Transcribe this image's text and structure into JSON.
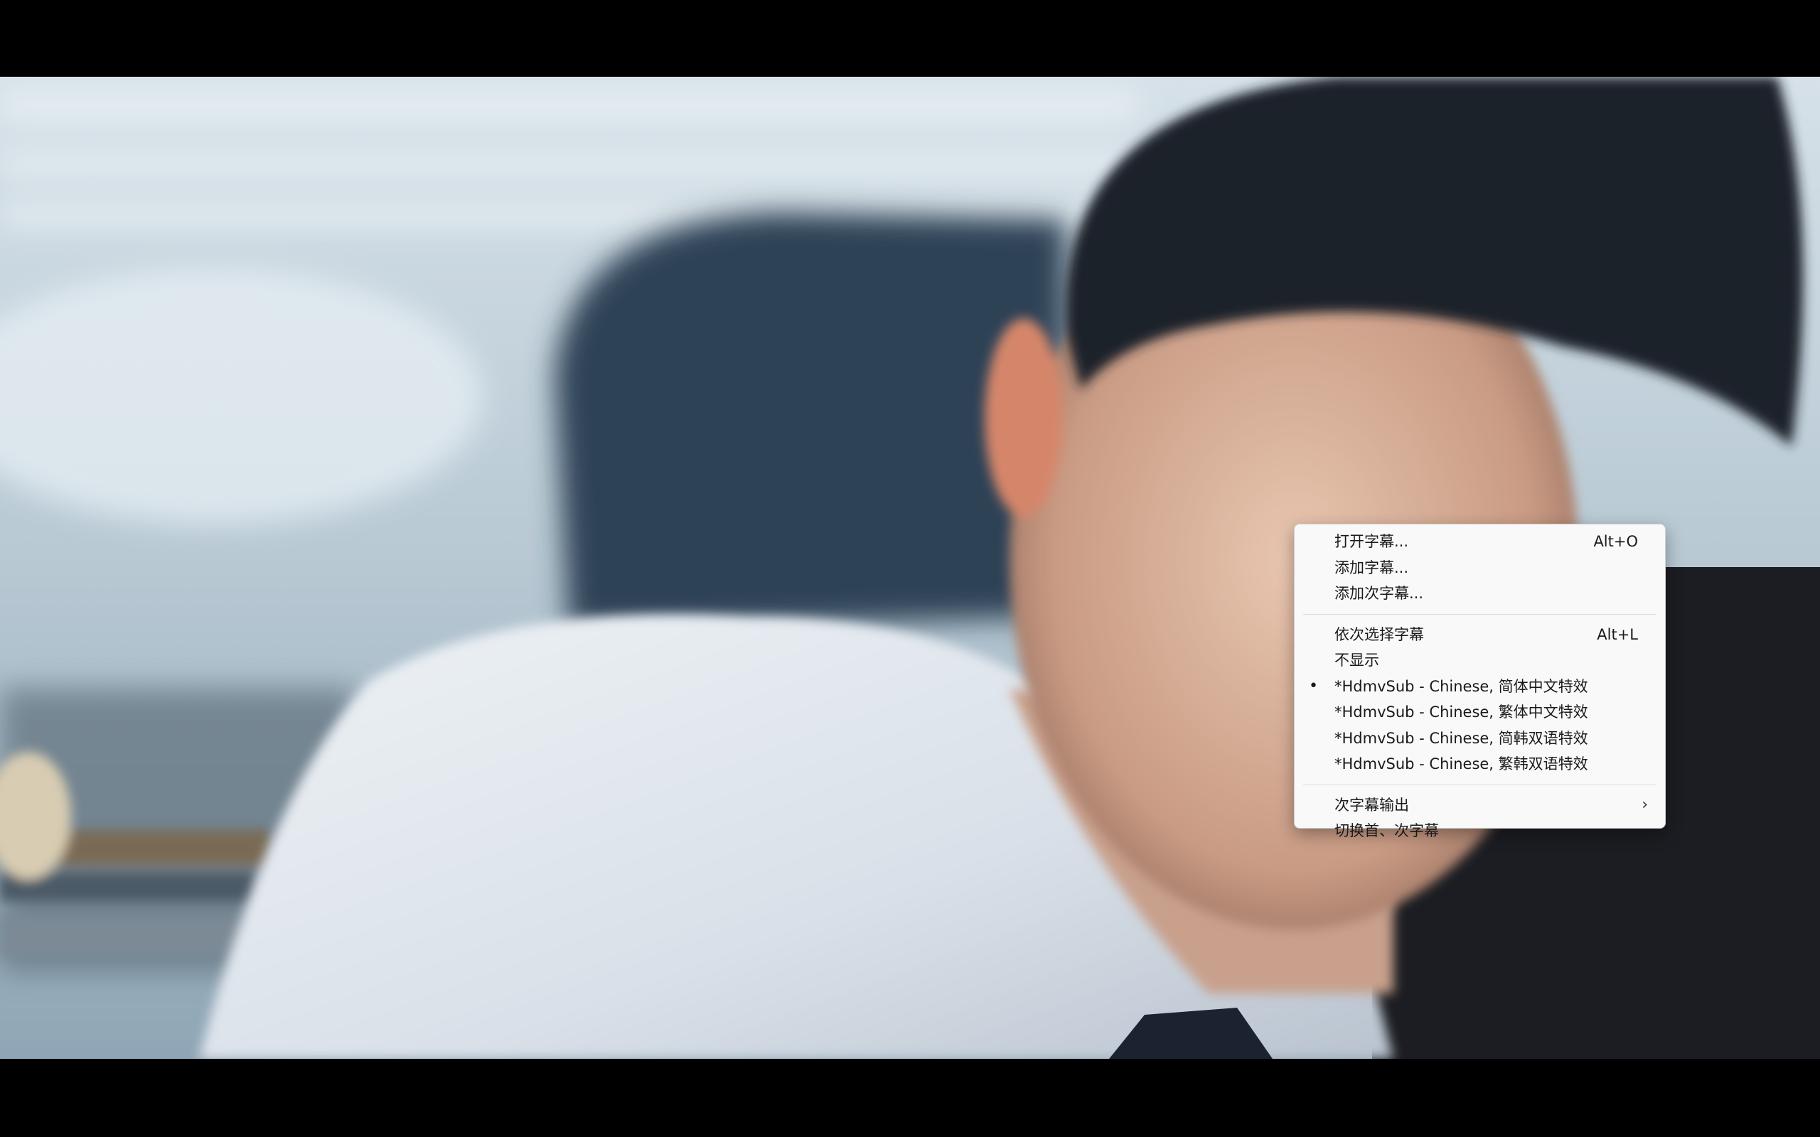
{
  "window": {
    "background": "#000000"
  },
  "context_menu": {
    "background": "#f9f9f9",
    "groups": [
      [
        {
          "label": "打开字幕...",
          "shortcut": "Alt+O"
        },
        {
          "label": "添加字幕...",
          "shortcut": ""
        },
        {
          "label": "添加次字幕...",
          "shortcut": ""
        }
      ],
      [
        {
          "label": "依次选择字幕",
          "shortcut": "Alt+L"
        },
        {
          "label": "不显示",
          "shortcut": ""
        },
        {
          "label": "*HdmvSub - Chinese, 简体中文特效",
          "shortcut": "",
          "selected": true
        },
        {
          "label": "*HdmvSub - Chinese, 繁体中文特效",
          "shortcut": ""
        },
        {
          "label": "*HdmvSub - Chinese, 简韩双语特效",
          "shortcut": ""
        },
        {
          "label": "*HdmvSub - Chinese, 繁韩双语特效",
          "shortcut": ""
        }
      ],
      [
        {
          "label": "次字幕输出",
          "shortcut": "",
          "submenu": true
        },
        {
          "label": "切换首、次字幕",
          "shortcut": ""
        }
      ]
    ],
    "icons": {
      "selected": "bullet-icon",
      "submenu": "chevron-right-icon"
    }
  }
}
